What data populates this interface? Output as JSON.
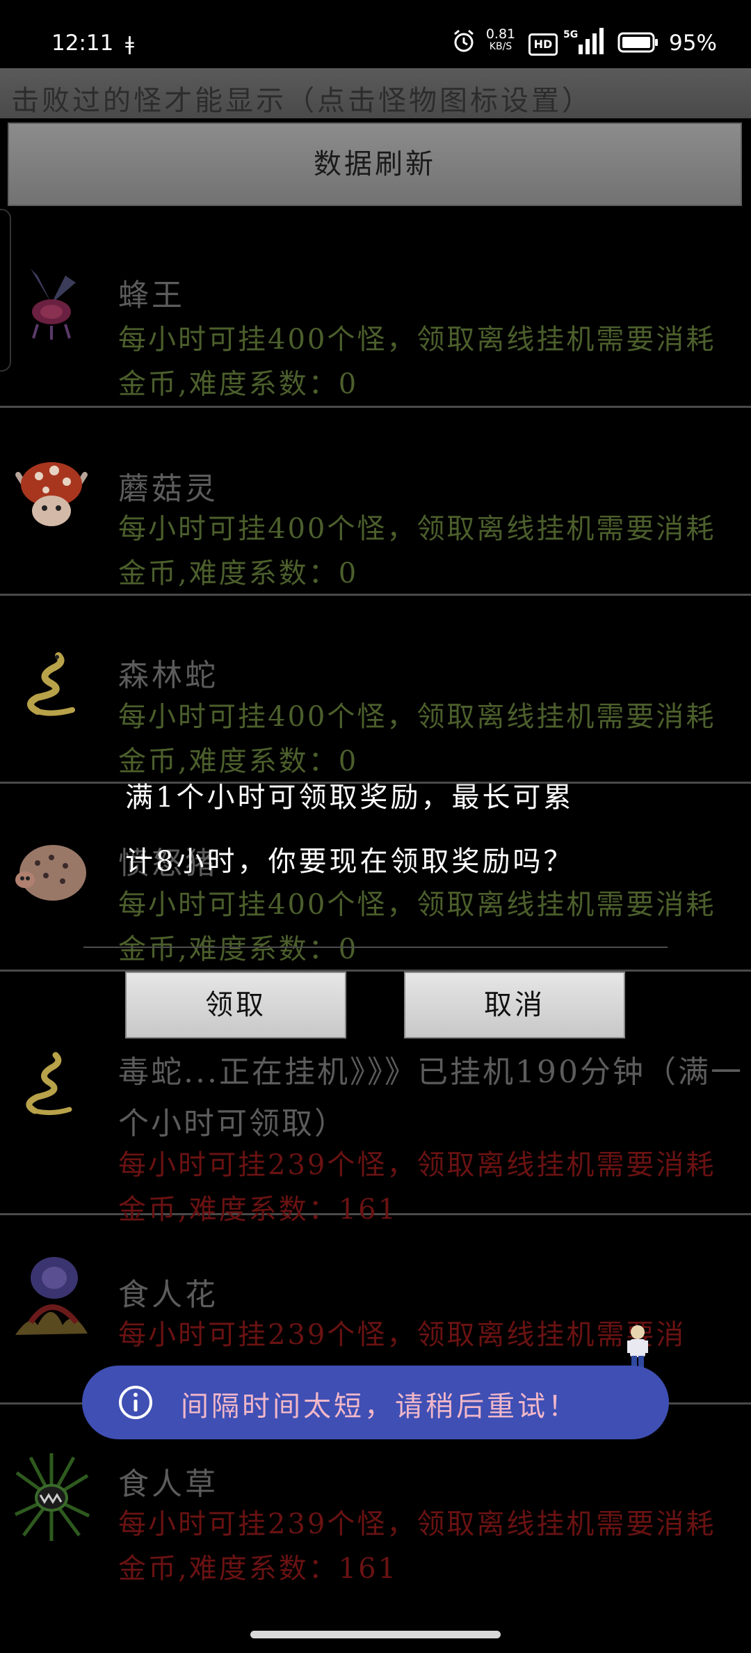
{
  "status_bar": {
    "time": "12:11",
    "wifi_glyph": "ǂ",
    "speed_value": "0.81",
    "speed_unit": "KB/S",
    "hd": "HD",
    "network": "5G",
    "battery": "95%"
  },
  "header": {
    "hint": "击败过的怪才能显示（点击怪物图标设置）",
    "refresh_label": "数据刷新"
  },
  "monsters": [
    {
      "name": "蜂王",
      "desc": "每小时可挂400个怪，领取离线挂机需要消耗金币,难度系数：0",
      "icon": "bee-king-icon"
    },
    {
      "name": "蘑菇灵",
      "desc": "每小时可挂400个怪，领取离线挂机需要消耗金币,难度系数：0",
      "icon": "mushroom-spirit-icon"
    },
    {
      "name": "森林蛇",
      "desc": "每小时可挂400个怪，领取离线挂机需要消耗金币,难度系数：0",
      "icon": "forest-snake-icon"
    },
    {
      "name": "愤怒猪",
      "desc": "每小时可挂400个怪，领取离线挂机需要消耗金币,难度系数：0",
      "icon": "angry-pig-icon"
    },
    {
      "name": "毒蛇",
      "status": "毒蛇...正在挂机》》》已挂机190分钟（满一个小时可领取）",
      "desc": "每小时可挂239个怪，领取离线挂机需要消耗金币,难度系数：161",
      "icon": "poison-snake-icon"
    },
    {
      "name": "食人花",
      "desc": "每小时可挂239个怪，领取离线挂机需要消",
      "icon": "man-eating-flower-icon"
    },
    {
      "name": "食人草",
      "desc": "每小时可挂239个怪，领取离线挂机需要消耗金币,难度系数：161",
      "icon": "man-eating-grass-icon"
    }
  ],
  "dialog": {
    "message_line1": "满1个小时可领取奖励，最长可累",
    "message_line2": "计8小时，你要现在领取奖励吗？",
    "confirm_label": "领取",
    "cancel_label": "取消"
  },
  "toast": {
    "message": "间隔时间太短，请稍后重试！",
    "icon": "info-icon",
    "background": "#3f4fb4",
    "text_color": "#f1b7c9"
  },
  "colors": {
    "green_text": "#4c5f2c",
    "red_text": "#6a1212"
  }
}
